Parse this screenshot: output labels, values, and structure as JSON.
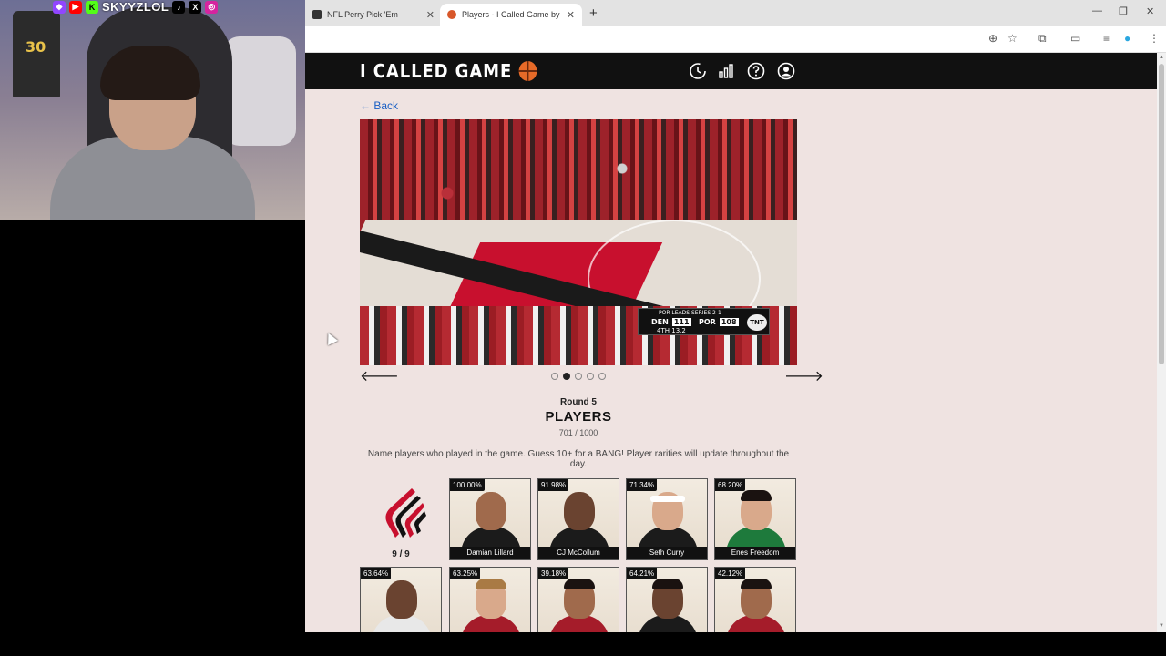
{
  "overlay": {
    "handle": "SKYYZLOL",
    "social_icons": [
      "twitch-icon",
      "youtube-icon",
      "kick-icon",
      "tiktok-icon",
      "x-icon",
      "instagram-icon"
    ],
    "jersey_number": "30"
  },
  "browser": {
    "tabs": [
      {
        "title": "NFL Perry Pick 'Em",
        "active": false
      },
      {
        "title": "Players - I Called Game by Hoo",
        "active": true
      }
    ],
    "new_tab_label": "+",
    "window_controls": [
      "minimize",
      "restore",
      "close"
    ]
  },
  "site": {
    "logo_text": "I CALLED GAME",
    "header_icons": [
      "history-icon",
      "stats-icon",
      "help-icon",
      "account-icon"
    ]
  },
  "nav": {
    "back_label": "← Back"
  },
  "carousel": {
    "dot_count": 5,
    "active_index": 1,
    "scorebug": {
      "series_text": "POR LEADS SERIES 2-1",
      "away_team": "DEN",
      "away_score": "111",
      "home_team": "POR",
      "home_score": "108",
      "period": "4TH",
      "clock": "13.2",
      "network": "TNT"
    }
  },
  "game": {
    "round": "Round 5",
    "category": "PLAYERS",
    "score": "701 / 1000",
    "instructions": "Name players who played in the game. Guess 10+ for a BANG! Player rarities will update throughout the day."
  },
  "team": {
    "count": "9 / 9",
    "colors": {
      "primary": "#c8102e",
      "secondary": "#000000"
    }
  },
  "players": [
    {
      "pct": "100.00%",
      "name": "Damian Lillard"
    },
    {
      "pct": "91.98%",
      "name": "CJ McCollum"
    },
    {
      "pct": "71.34%",
      "name": "Seth Curry"
    },
    {
      "pct": "68.20%",
      "name": "Enes Freedom"
    },
    {
      "pct": "63.64%",
      "name": ""
    },
    {
      "pct": "63.25%",
      "name": ""
    },
    {
      "pct": "39.18%",
      "name": ""
    },
    {
      "pct": "64.21%",
      "name": ""
    },
    {
      "pct": "42.12%",
      "name": ""
    }
  ],
  "colors": {
    "page_bg": "#efe3e1",
    "header_bg": "#111111",
    "link": "#1a5fc4",
    "accent": "#e66a28"
  }
}
